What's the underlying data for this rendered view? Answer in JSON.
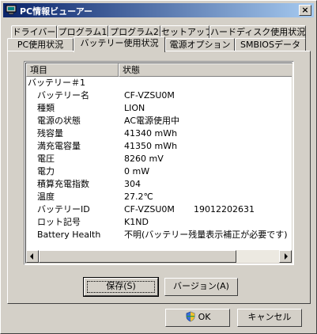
{
  "window": {
    "title": "PC情報ビューアー",
    "close_label": "×"
  },
  "tabs": {
    "row1": [
      "ドライバー",
      "プログラム1",
      "プログラム2",
      "セットアップ",
      "ハードディスク使用状況"
    ],
    "row2": [
      "PC使用状況",
      "バッテリー使用状況",
      "電源オプション",
      "SMBIOSデータ"
    ],
    "active": "バッテリー使用状況"
  },
  "list": {
    "columns": [
      "項目",
      "状態"
    ],
    "rows": [
      [
        "バッテリー＃1",
        "",
        ""
      ],
      [
        "バッテリー名",
        "CF-VZSU0M",
        ""
      ],
      [
        "種類",
        "LION",
        ""
      ],
      [
        "電源の状態",
        "AC電源使用中",
        ""
      ],
      [
        "残容量",
        "41340 mWh",
        ""
      ],
      [
        "満充電容量",
        "41350 mWh",
        ""
      ],
      [
        "電圧",
        "8260 mV",
        ""
      ],
      [
        "電力",
        "0 mW",
        ""
      ],
      [
        "積算充電指数",
        "304",
        ""
      ],
      [
        "温度",
        "27.2℃",
        ""
      ],
      [
        "バッテリーID",
        "CF-VZSU0M",
        "19012202631"
      ],
      [
        "ロット記号",
        "K1ND",
        ""
      ],
      [
        "Battery Health",
        "不明(バッテリー残量表示補正が必要です)",
        ""
      ]
    ]
  },
  "buttons": {
    "save": "保存(S)",
    "version": "バージョン(A)",
    "ok": "OK",
    "cancel": "キャンセル"
  },
  "icons": {
    "scroll_left": "◄",
    "scroll_right": "►"
  }
}
